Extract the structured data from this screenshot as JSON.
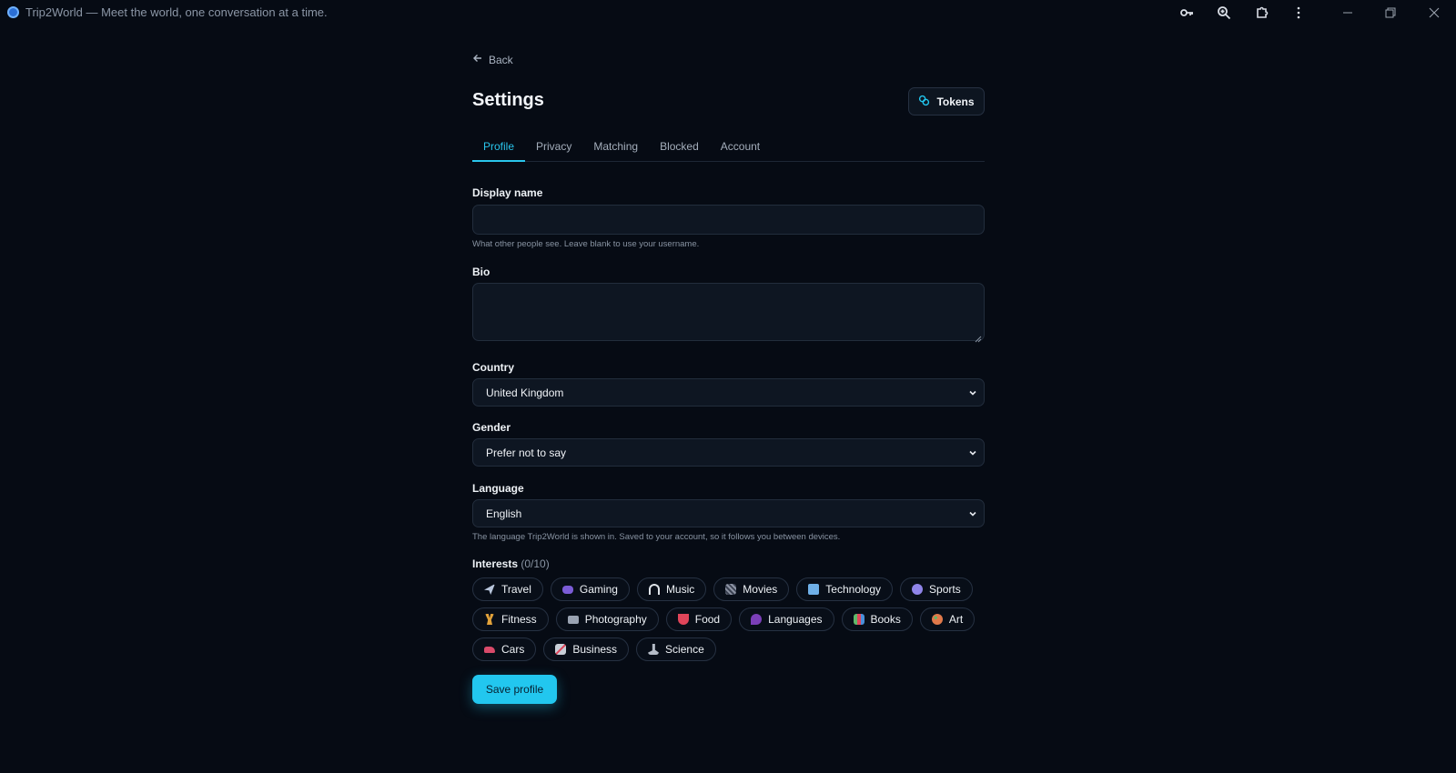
{
  "window": {
    "title": "Trip2World — Meet the world, one conversation at a time."
  },
  "nav": {
    "back_label": "Back"
  },
  "page": {
    "title": "Settings",
    "tokens_label": "Tokens"
  },
  "tabs": [
    {
      "label": "Profile",
      "active": true
    },
    {
      "label": "Privacy"
    },
    {
      "label": "Matching"
    },
    {
      "label": "Blocked"
    },
    {
      "label": "Account"
    }
  ],
  "form": {
    "display_name": {
      "label": "Display name",
      "value": "",
      "hint": "What other people see. Leave blank to use your username."
    },
    "bio": {
      "label": "Bio",
      "value": ""
    },
    "country": {
      "label": "Country",
      "value": "United Kingdom"
    },
    "gender": {
      "label": "Gender",
      "value": "Prefer not to say"
    },
    "language": {
      "label": "Language",
      "value": "English",
      "hint": "The language Trip2World is shown in. Saved to your account, so it follows you between devices."
    }
  },
  "interests": {
    "label": "Interests",
    "count": "(0/10)",
    "rows": [
      [
        {
          "label": "Travel",
          "icon": "airplane-icon",
          "color": "#b9c6dc"
        },
        {
          "label": "Gaming",
          "icon": "gamepad-icon",
          "color": "#7b5cd6"
        },
        {
          "label": "Music",
          "icon": "headphones-icon",
          "color": "#dfe4ea"
        },
        {
          "label": "Movies",
          "icon": "clapperboard-icon",
          "color": "#8c93a3"
        },
        {
          "label": "Technology",
          "icon": "laptop-icon",
          "color": "#6fb0e8"
        },
        {
          "label": "Sports",
          "icon": "ball-icon",
          "color": "#8f84e8"
        }
      ],
      [
        {
          "label": "Fitness",
          "icon": "weightlifter-icon",
          "color": "#e2a23a"
        },
        {
          "label": "Photography",
          "icon": "camera-icon",
          "color": "#9aa3b2"
        },
        {
          "label": "Food",
          "icon": "food-icon",
          "color": "#e0455a"
        },
        {
          "label": "Languages",
          "icon": "speech-icon",
          "color": "#7b3fb8"
        },
        {
          "label": "Books",
          "icon": "books-icon",
          "color": "#5fb86a"
        },
        {
          "label": "Art",
          "icon": "palette-icon",
          "color": "#e0794a"
        }
      ],
      [
        {
          "label": "Cars",
          "icon": "car-icon",
          "color": "#d94a6a"
        },
        {
          "label": "Business",
          "icon": "chart-icon",
          "color": "#c9cfd8"
        },
        {
          "label": "Science",
          "icon": "microscope-icon",
          "color": "#b5bcc7"
        }
      ]
    ]
  },
  "actions": {
    "save_label": "Save profile"
  },
  "colors": {
    "accent": "#22c7ef",
    "background": "#060b14",
    "field_bg": "#0e1622"
  }
}
